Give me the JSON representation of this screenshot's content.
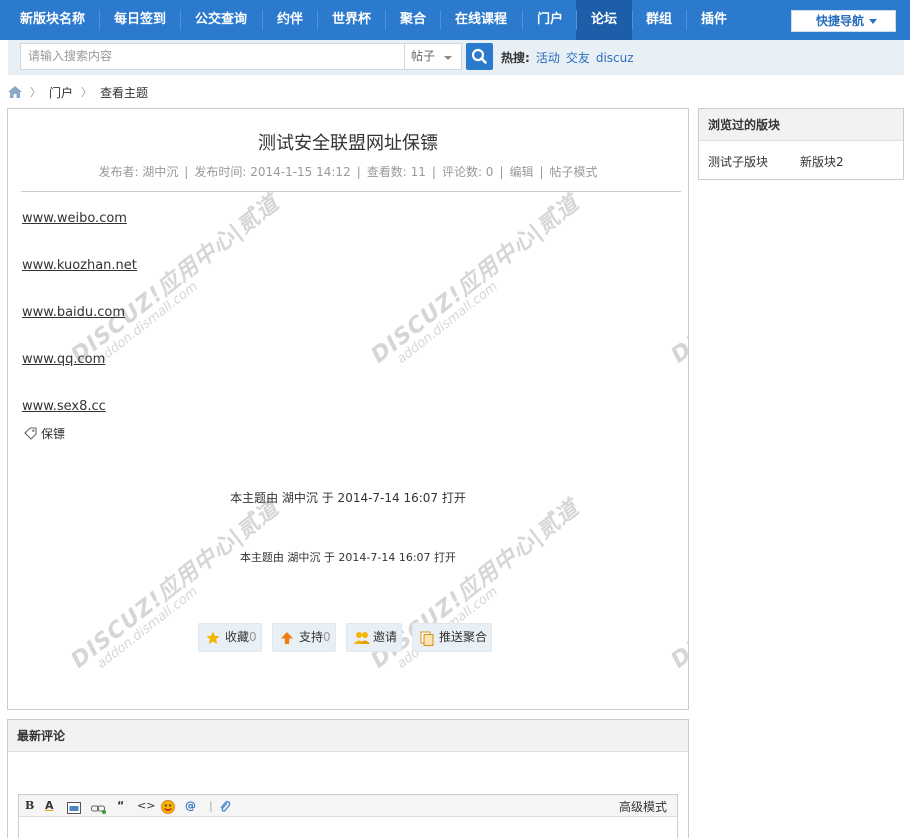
{
  "topnav": {
    "items": [
      "新版块名称",
      "每日签到",
      "公交查询",
      "约伴",
      "世界杯",
      "聚合",
      "在线课程",
      "门户",
      "论坛",
      "群组",
      "插件"
    ],
    "active_index": 8,
    "quick_nav_label": "快捷导航"
  },
  "search": {
    "placeholder": "请输入搜索内容",
    "type_label": "帖子",
    "hot_label": "热搜:",
    "hot_items": [
      "活动",
      "交友",
      "discuz"
    ]
  },
  "breadcrumb": {
    "items": [
      "门户",
      "查看主题"
    ]
  },
  "post": {
    "title": "测试安全联盟网址保镖",
    "meta": {
      "author": "发布者: 湖中沉",
      "time": "发布时间: 2014-1-15 14:12",
      "views": "查看数: 11",
      "comments": "评论数: 0",
      "edit": "编辑",
      "mode": "帖子模式"
    },
    "links": [
      "www.weibo.com",
      "www.kuozhan.net",
      "www.baidu.com",
      "www.qq.com",
      "www.sex8.cc"
    ],
    "tag": "保镖",
    "notice_primary": "本主题由 湖中沉 于 2014-7-14 16:07 打开",
    "notice_secondary": "本主题由 湖中沉 于 2014-7-14 16:07 打开",
    "actions": {
      "favorite_label": "收藏",
      "favorite_count": "0",
      "support_label": "支持",
      "support_count": "0",
      "invite_label": "邀请",
      "push_label": "推送聚合"
    }
  },
  "watermark": {
    "brand": "DISCUZ!应用中心|贰道",
    "site": "addon.dismall.com"
  },
  "sidebar": {
    "title": "浏览过的版块",
    "items": [
      "测试子版块",
      "新版块2"
    ]
  },
  "comments": {
    "title": "最新评论",
    "advanced_mode": "高级模式"
  },
  "colors": {
    "nav_bg": "#2b7acd",
    "nav_active": "#1c5fa8",
    "link_blue": "#2b6fc0"
  }
}
